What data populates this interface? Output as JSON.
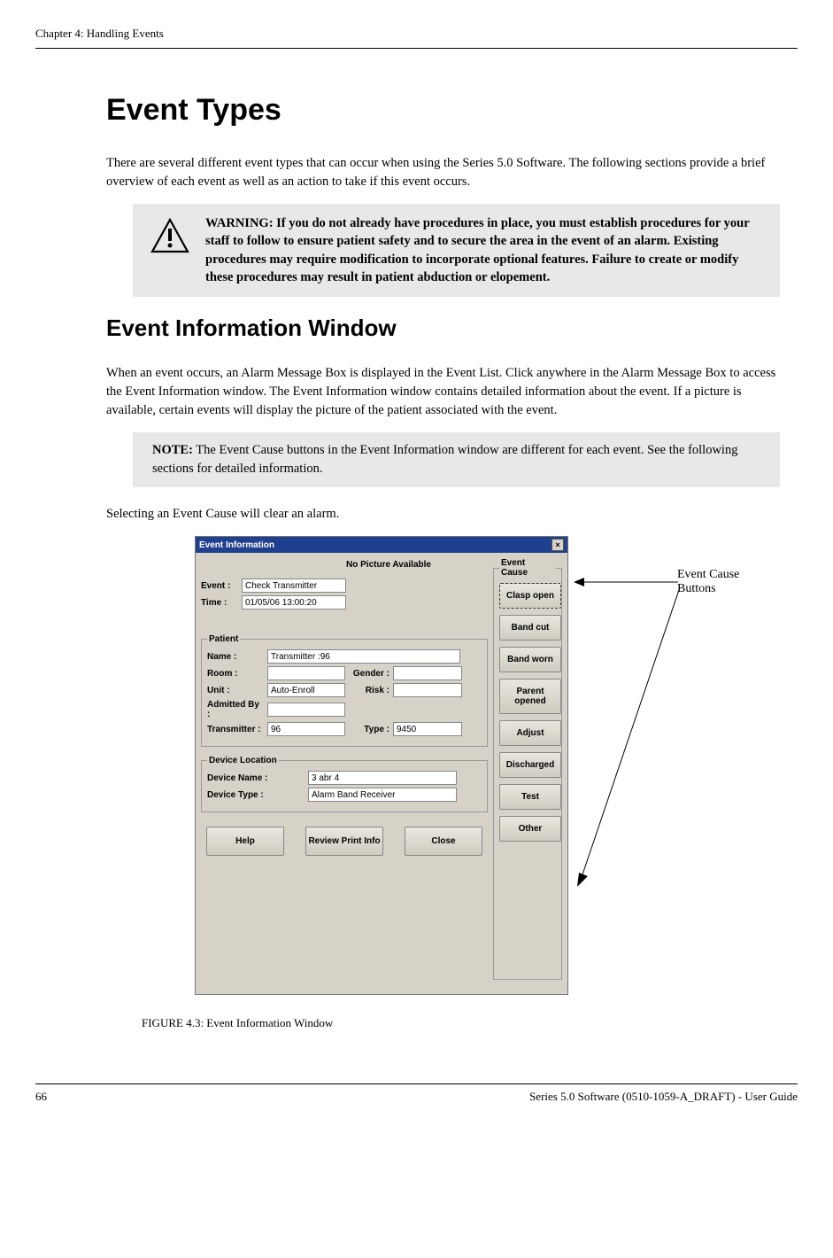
{
  "header": {
    "chapter": "Chapter 4: Handling Events"
  },
  "h1": "Event Types",
  "intro": "There are several different event types that can occur when using the Series 5.0 Software. The following sections provide a brief overview of each event as well as an action to take if this event occurs.",
  "warning": "WARNING: If you do not already have procedures in place, you must establish procedures for your staff to follow to ensure patient safety and to secure the area in the event of an alarm. Existing procedures may require modification to incorporate optional features. Failure to create or modify these procedures may result in patient abduction or elopement.",
  "h2": "Event Information Window",
  "para2": "When an event occurs, an Alarm Message Box is displayed in the Event List. Click anywhere in the Alarm Message Box to access the Event Information window. The Event Information window contains detailed information about the event. If a picture is available, certain events will display the picture of the patient associated with the event.",
  "note_label": "NOTE:",
  "note_text": " The Event Cause buttons in the Event Information window are different for each event. See the following sections for detailed information.",
  "para3": "Selecting an Event Cause will clear an alarm.",
  "dialog": {
    "title": "Event Information",
    "no_picture": "No Picture Available",
    "labels": {
      "event": "Event :",
      "time": "Time :",
      "patient_legend": "Patient",
      "name": "Name :",
      "room": "Room :",
      "gender": "Gender :",
      "unit": "Unit :",
      "risk": "Risk :",
      "admitted_by": "Admitted By :",
      "transmitter": "Transmitter :",
      "type": "Type :",
      "device_legend": "Device Location",
      "device_name": "Device Name :",
      "device_type": "Device Type :",
      "cause_legend": "Event Cause"
    },
    "values": {
      "event": "Check Transmitter",
      "time": "01/05/06 13:00:20",
      "name": "Transmitter :96",
      "room": "",
      "gender": "",
      "unit": "Auto-Enroll",
      "risk": "",
      "admitted_by": "",
      "transmitter": "96",
      "type": "9450",
      "device_name": "3 abr 4",
      "device_type": "Alarm Band Receiver"
    },
    "cause_buttons": [
      "Clasp open",
      "Band cut",
      "Band worn",
      "Parent opened",
      "Adjust",
      "Discharged",
      "Test",
      "Other"
    ],
    "bottom_buttons": {
      "help": "Help",
      "review": "Review Print Info",
      "close": "Close"
    }
  },
  "annotation": {
    "line1": "Event Cause",
    "line2": "Buttons"
  },
  "figure_caption": "FIGURE 4.3:    Event Information Window",
  "footer": {
    "page": "66",
    "doc": "Series 5.0 Software (0510-1059-A_DRAFT) - User Guide"
  }
}
